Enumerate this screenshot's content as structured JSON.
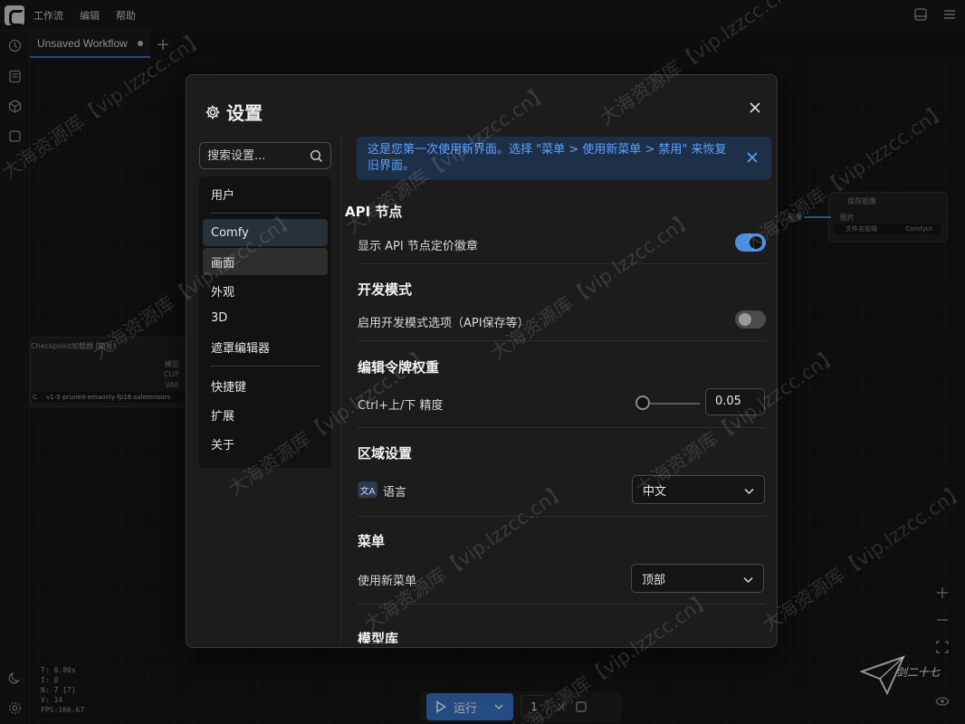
{
  "menubar": {
    "items": [
      "工作流",
      "编辑",
      "帮助"
    ]
  },
  "tabs": [
    {
      "label": "Unsaved Workflow"
    }
  ],
  "background": {
    "checkpoint_node": {
      "title": "Checkpoint加载器 (简易)",
      "outputs": [
        "模型",
        "CLIP",
        "VAE"
      ],
      "ckpt_value": "v1-5-pruned-emaonly-fp16.safetensors",
      "ckpt_prefix": "C"
    },
    "save_node": {
      "title": "保存图像",
      "input": "图片",
      "left_port": "图像",
      "field_label": "文件名前缀",
      "field_value": "ComfyUI"
    },
    "stats": [
      "T: 0.00s",
      "I: 0",
      "N: 7 [7]",
      "V: 14",
      "FPS:166.67"
    ]
  },
  "runbar": {
    "run_label": "运行",
    "count": "1"
  },
  "dialog": {
    "title": "设置",
    "search": {
      "placeholder": "搜索设置..."
    },
    "nav": {
      "group1": [
        "用户"
      ],
      "group2": [
        "Comfy",
        "画面",
        "外观",
        "3D",
        "遮罩编辑器"
      ],
      "group3": [
        "快捷键",
        "扩展",
        "关于"
      ]
    },
    "banner": "这是您第一次使用新界面。选择 \"菜单 > 使用新菜单 > 禁用\" 来恢复旧界面。",
    "sections": {
      "api": {
        "title": "API 节点",
        "label": "显示 API 节点定价徽章",
        "toggle_on": true
      },
      "dev": {
        "title": "开发模式",
        "label": "启用开发模式选项（API保存等）",
        "toggle_on": false
      },
      "token": {
        "title": "编辑令牌权重",
        "label": "Ctrl+上/下 精度",
        "value": "0.05",
        "slider_level": 0.05
      },
      "locale": {
        "title": "区域设置",
        "label": "语言",
        "value": "中文",
        "icon_text": "文A"
      },
      "menu": {
        "title": "菜单",
        "label": "使用新菜单",
        "value": "顶部"
      },
      "model_lib": {
        "title": "模型库"
      }
    }
  },
  "watermark": {
    "text": "大海资源库【vip.lzzcc.cn】",
    "signature": "剑二十七"
  },
  "colors": {
    "accent": "#3a73c9",
    "toggle_on": "#4a8fe0",
    "banner_bg": "#1e3048",
    "banner_text": "#5aa2ff"
  }
}
